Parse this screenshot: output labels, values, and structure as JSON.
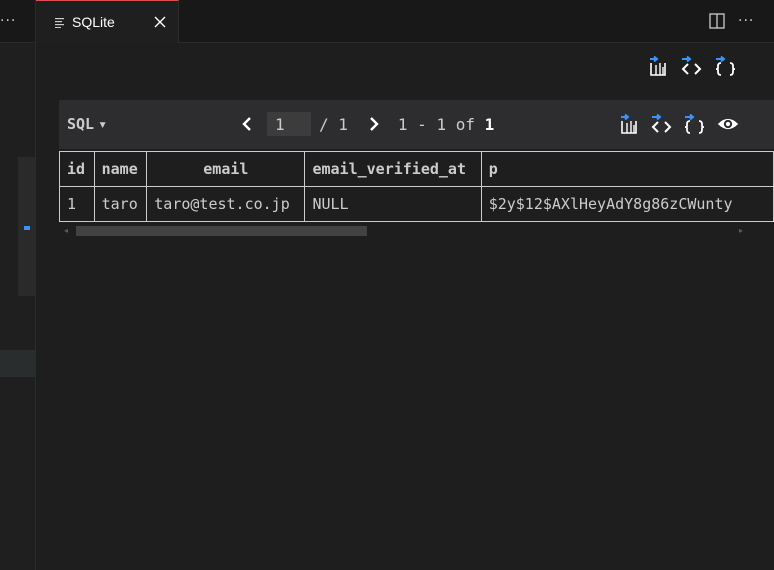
{
  "left_panel": {
    "more_label": "···"
  },
  "tab": {
    "title": "SQLite"
  },
  "editor_actions": {
    "more_label": "···"
  },
  "result": {
    "mode_label": "SQL",
    "mode_caret": "▾",
    "pager": {
      "page_value": "1",
      "page_total": "/ 1",
      "range_text": "1 - 1 of",
      "total_rows": "1"
    },
    "columns": [
      "id",
      "name",
      "email",
      "email_verified_at",
      "p"
    ],
    "rows": [
      [
        "1",
        "taro",
        "taro@test.co.jp",
        "NULL",
        "$2y$12$AXlHeyAdY8g86zCWunty"
      ]
    ]
  },
  "colors": {
    "accent_tab_border": "#e74c4c",
    "icon_blue": "#3794ff",
    "background": "#1e1e1e"
  },
  "icons": [
    "list-icon",
    "close-icon",
    "split-editor-icon",
    "export-csv-icon",
    "export-html-icon",
    "export-json-icon",
    "eye-icon",
    "chevron-left-icon",
    "chevron-right-icon"
  ]
}
